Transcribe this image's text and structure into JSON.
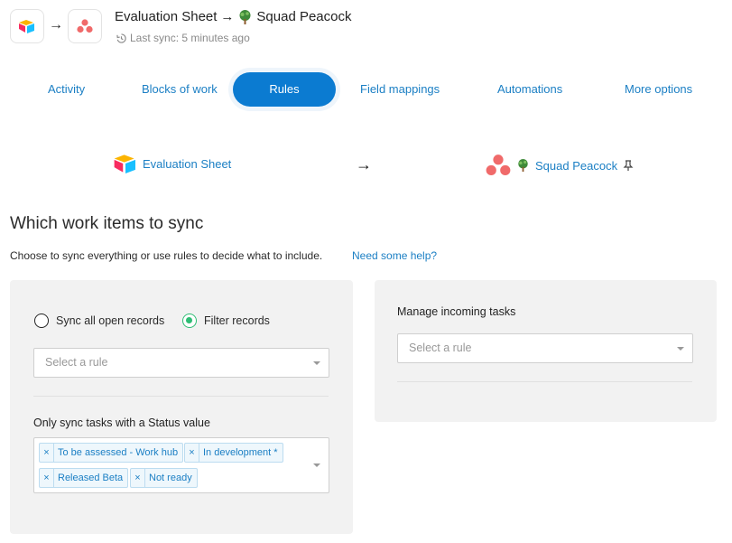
{
  "header": {
    "source_name": "Evaluation Sheet",
    "arrow": "→",
    "target_name": "Squad Peacock",
    "last_sync": "Last sync: 5 minutes ago"
  },
  "tabs": [
    {
      "label": "Activity",
      "active": false
    },
    {
      "label": "Blocks of work",
      "active": false
    },
    {
      "label": "Rules",
      "active": true
    },
    {
      "label": "Field mappings",
      "active": false
    },
    {
      "label": "Automations",
      "active": false
    },
    {
      "label": "More options",
      "active": false
    }
  ],
  "flow": {
    "source": "Evaluation Sheet",
    "arrow": "→",
    "target": "Squad Peacock"
  },
  "section": {
    "title": "Which work items to sync",
    "description": "Choose to sync everything or use rules to decide what to include.",
    "help_link": "Need some help?"
  },
  "left_panel": {
    "radio_all": "Sync all open records",
    "radio_filter": "Filter records",
    "selected_option": "Filter records",
    "rule_placeholder": "Select a rule",
    "status_label": "Only sync tasks with a Status value",
    "status_values": [
      "To be assessed - Work hub",
      "In development *",
      "Released Beta",
      "Not ready"
    ]
  },
  "right_panel": {
    "title": "Manage incoming tasks",
    "rule_placeholder": "Select a rule"
  },
  "colors": {
    "accent": "#0b7bd1",
    "link": "#1b7fc4",
    "radio_checked": "#2ebd74",
    "panel_bg": "#f2f2f2"
  },
  "icons": [
    "airtable-logo-icon",
    "asana-logo-icon",
    "peacock-tree-icon",
    "history-icon",
    "pin-icon"
  ]
}
